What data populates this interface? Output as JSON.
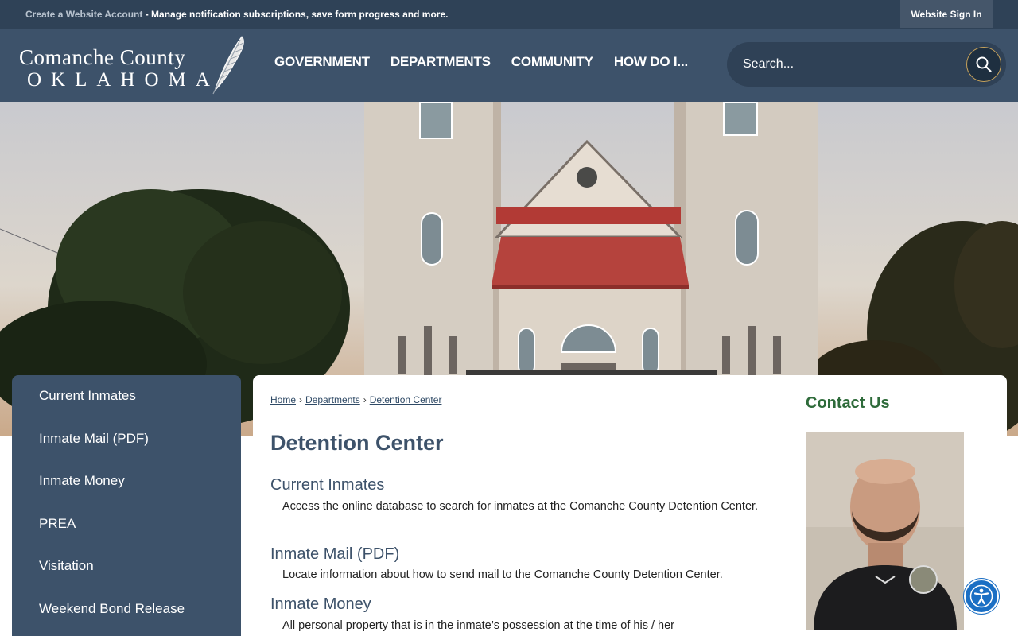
{
  "topbar": {
    "account_link": "Create a Website Account",
    "account_text": " - Manage notification subscriptions, save form progress and more.",
    "signin_label": "Website Sign In"
  },
  "header": {
    "logo_line1": "Comanche County",
    "logo_line2": "OKLAHOMA",
    "nav": [
      "GOVERNMENT",
      "DEPARTMENTS",
      "COMMUNITY",
      "HOW DO I..."
    ],
    "search_placeholder": "Search..."
  },
  "sidebar": {
    "items": [
      "Current Inmates",
      "Inmate Mail (PDF)",
      "Inmate Money",
      "PREA",
      "Visitation",
      "Weekend Bond Release"
    ]
  },
  "breadcrumb": [
    "Home",
    "Departments",
    "Detention Center"
  ],
  "page_title": "Detention Center",
  "sections": [
    {
      "heading": "Current Inmates",
      "text": "Access the online database to search for inmates at the Comanche County Detention Center."
    },
    {
      "heading": "Inmate Mail (PDF)",
      "text": "Locate information about how to send mail to the Comanche County Detention Center."
    },
    {
      "heading": "Inmate Money",
      "text": "All personal property that is in the inmate’s possession at the time of his / her"
    }
  ],
  "contact": {
    "heading": "Contact Us"
  },
  "colors": {
    "navy": "#3d526a",
    "dark_navy": "#2f4257",
    "contact_green": "#2e6b3a",
    "accent_gold": "#c9a35a",
    "a11y_blue": "#1b6fc4"
  }
}
